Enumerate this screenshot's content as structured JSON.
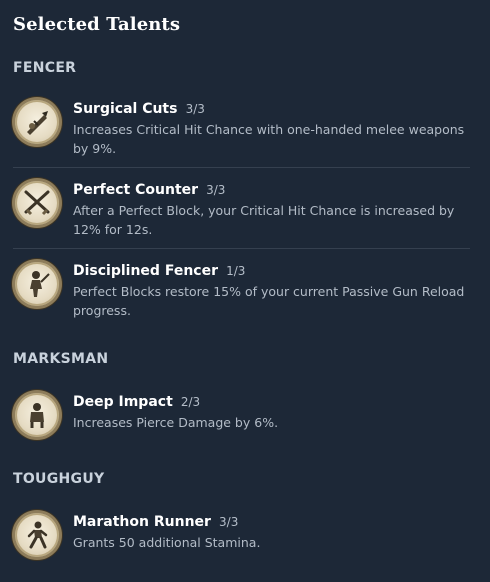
{
  "title": "Selected Talents",
  "sections": [
    {
      "name": "FENCER",
      "talents": [
        {
          "name": "Surgical Cuts",
          "rank": "3/3",
          "description": "Increases Critical Hit Chance with one-handed melee weapons by 9%.",
          "icon": "surgical-cuts-icon"
        },
        {
          "name": "Perfect Counter",
          "rank": "3/3",
          "description": "After a Perfect Block, your Critical Hit Chance is increased by 12% for 12s.",
          "icon": "crossed-swords-icon"
        },
        {
          "name": "Disciplined Fencer",
          "rank": "1/3",
          "description": "Perfect Blocks restore 15% of your current Passive Gun Reload progress.",
          "icon": "fencer-figure-icon"
        }
      ]
    },
    {
      "name": "MARKSMAN",
      "talents": [
        {
          "name": "Deep Impact",
          "rank": "2/3",
          "description": "Increases Pierce Damage by 6%.",
          "icon": "deep-impact-icon"
        }
      ]
    },
    {
      "name": "TOUGHGUY",
      "talents": [
        {
          "name": "Marathon Runner",
          "rank": "3/3",
          "description": "Grants 50 additional Stamina.",
          "icon": "runner-icon"
        }
      ]
    }
  ],
  "colors": {
    "background": "#1d2837",
    "icon_ring": "#8d7c5a",
    "icon_face": "#e6dcc4"
  }
}
